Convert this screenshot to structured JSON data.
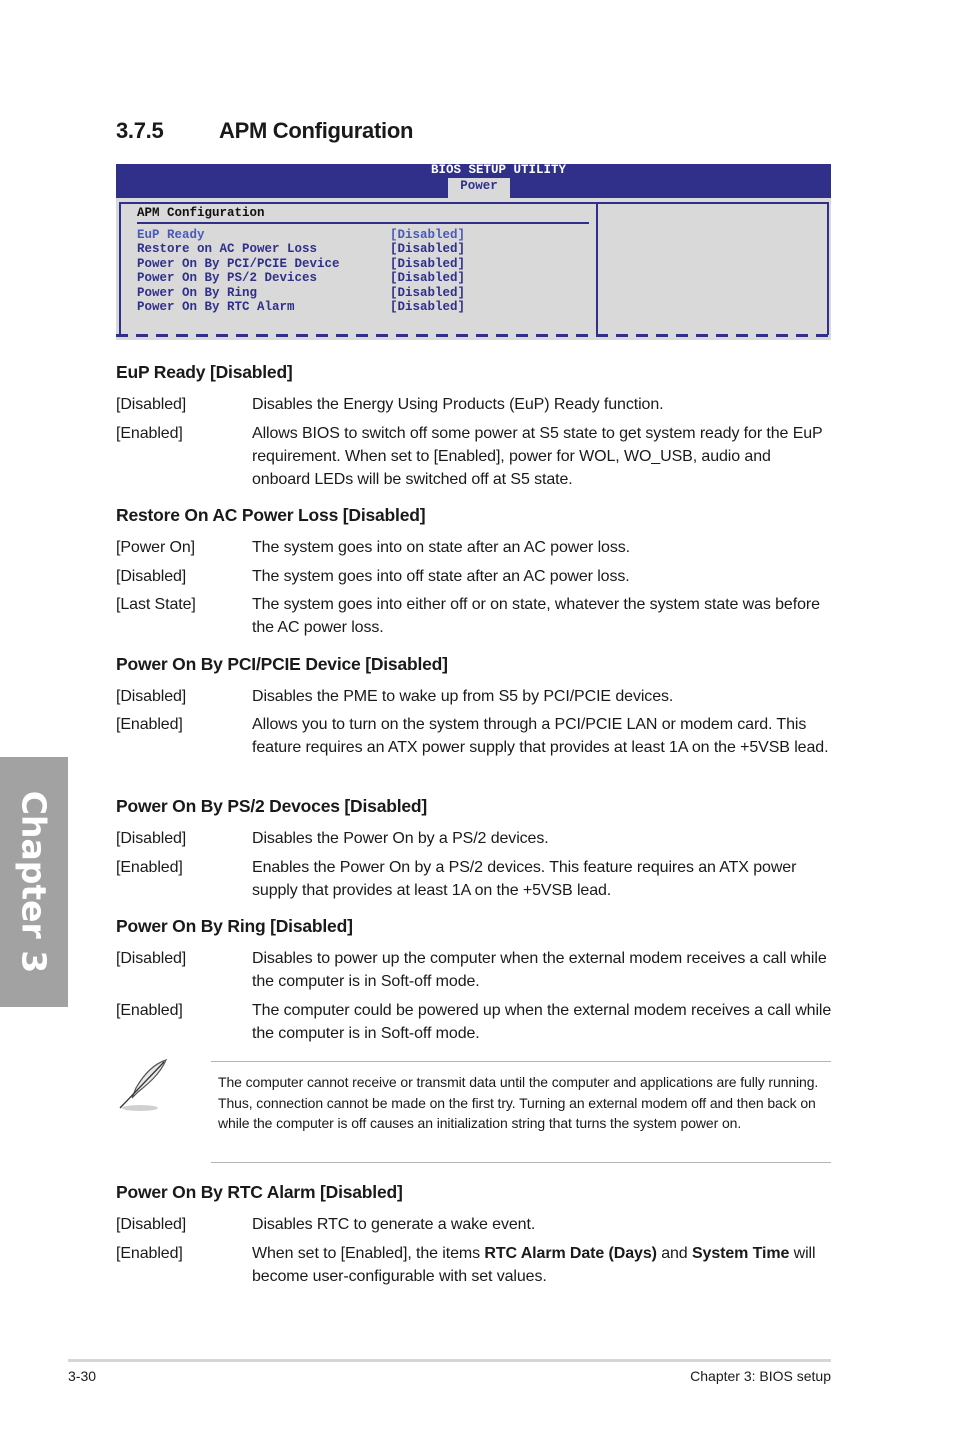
{
  "section": {
    "number": "3.7.5",
    "title": "APM Configuration"
  },
  "bios": {
    "utility_title": "BIOS SETUP UTILITY",
    "active_tab": "Power",
    "panel_title": "APM Configuration",
    "items": [
      {
        "label": "EuP Ready",
        "value": "[Disabled]"
      },
      {
        "label": "Restore on AC Power Loss",
        "value": "[Disabled]"
      },
      {
        "label": "Power On By PCI/PCIE Device",
        "value": "[Disabled]"
      },
      {
        "label": "Power On By PS/2 Devices",
        "value": "[Disabled]"
      },
      {
        "label": "Power On By Ring",
        "value": "[Disabled]"
      },
      {
        "label": "Power On By RTC Alarm",
        "value": "[Disabled]"
      }
    ]
  },
  "descriptions": [
    {
      "title": "EuP Ready [Disabled]",
      "options": [
        {
          "key": "[Disabled]",
          "text": "Disables the Energy Using Products (EuP) Ready function."
        },
        {
          "key": "[Enabled]",
          "text": "Allows BIOS to switch off some power at S5 state to get system ready for the EuP requirement. When set to [Enabled], power for WOL, WO_USB, audio and onboard LEDs will be switched off at S5 state."
        }
      ]
    },
    {
      "title": "Restore On AC Power Loss [Disabled]",
      "options": [
        {
          "key": "[Power On]",
          "text": "The system goes into on state after an AC power loss."
        },
        {
          "key": "[Disabled]",
          "text": "The system goes into off state after an AC power loss."
        },
        {
          "key": "[Last State]",
          "text": "The system goes into either off or on state, whatever the system state was before the AC power loss."
        }
      ]
    },
    {
      "title": "Power On By PCI/PCIE Device [Disabled]",
      "options": [
        {
          "key": "[Disabled]",
          "text": "Disables the PME to wake up from S5 by PCI/PCIE devices."
        },
        {
          "key": "[Enabled]",
          "text": "Allows you to turn on the system through a PCI/PCIE LAN or modem card. This feature requires an ATX power supply that provides at least 1A on the +5VSB lead."
        }
      ]
    },
    {
      "title": "Power On By PS/2 Devoces [Disabled]",
      "options": [
        {
          "key": "[Disabled]",
          "text": "Disables the Power On by a PS/2 devices."
        },
        {
          "key": "[Enabled]",
          "text": "Enables the Power On by a PS/2 devices. This feature requires an ATX power supply that provides at least 1A on the +5VSB lead."
        }
      ]
    },
    {
      "title": "Power On By Ring [Disabled]",
      "options": [
        {
          "key": "[Disabled]",
          "text": "Disables to power up the computer when the external modem receives a call while the computer is in Soft-off mode."
        },
        {
          "key": "[Enabled]",
          "text": "The computer could be powered up when the external modem receives a call while the computer is in Soft-off mode."
        }
      ]
    },
    {
      "title": "Power On By RTC Alarm [Disabled]",
      "options": [
        {
          "key": "[Disabled]",
          "text": "Disables RTC to generate a wake event."
        },
        {
          "key": "[Enabled]",
          "text_parts": [
            "When set to [Enabled], the items ",
            "RTC Alarm Date (Days)",
            " and ",
            "System Time",
            " will become user-configurable with set values."
          ]
        }
      ]
    }
  ],
  "note": {
    "icon": "feather-pen-icon",
    "text": "The computer cannot receive or transmit data until the computer and applications are fully running. Thus, connection cannot be made on the first try. Turning an external modem off and then back on while the computer is off causes an initialization string that turns the system power on."
  },
  "chapter_tab": "Chapter 3",
  "footer": {
    "page": "3-30",
    "chapter": "Chapter 3: BIOS setup"
  }
}
